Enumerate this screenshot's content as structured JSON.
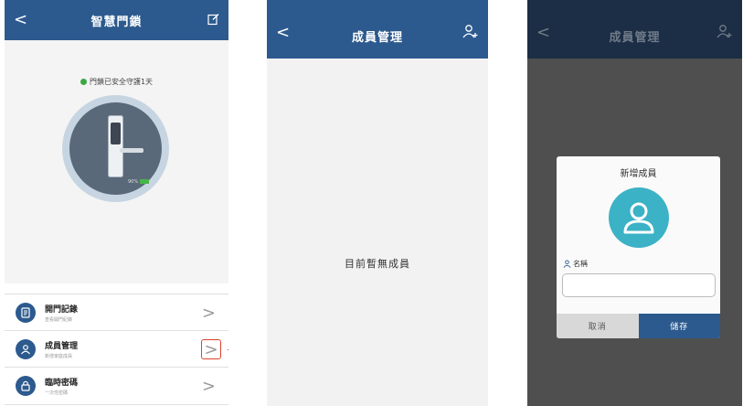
{
  "home": {
    "title": "智慧門鎖",
    "back_label": "<",
    "status_text": "門鎖已安全守護1天",
    "battery_text": "90%",
    "menu": [
      {
        "title": "開門記錄",
        "subtitle": "查看開門紀錄"
      },
      {
        "title": "成員管理",
        "subtitle": "新增家庭成員"
      },
      {
        "title": "臨時密碼",
        "subtitle": "一次性密碼"
      }
    ],
    "chevron": ">"
  },
  "members": {
    "title": "成員管理",
    "back_label": "<",
    "empty_message": "目前暫無成員"
  },
  "add_member": {
    "title": "成員管理",
    "back_label": "<",
    "dialog_title": "新增成員",
    "name_label": "名稱",
    "name_value": "",
    "cancel_label": "取消",
    "save_label": "儲存"
  },
  "colors": {
    "header_blue": "#2c5a8e",
    "dark_header": "#1c2e45",
    "accent_red": "#e0412b",
    "avatar_teal": "#3bb2c6",
    "status_green": "#3aa845"
  }
}
